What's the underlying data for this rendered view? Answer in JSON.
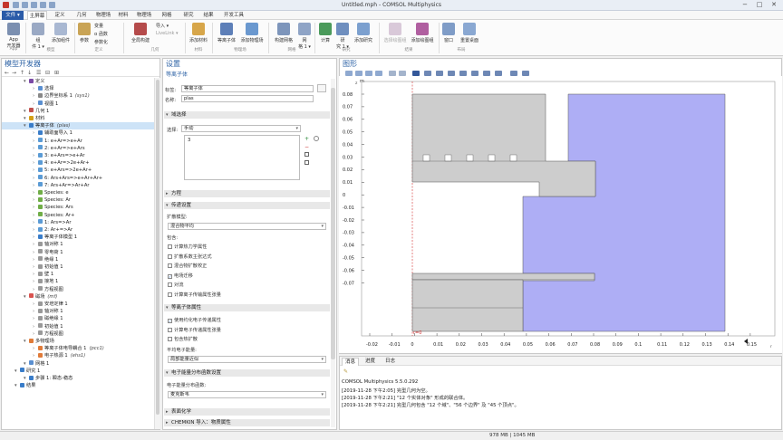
{
  "window": {
    "title": "Untitled.mph - COMSOL Multiphysics",
    "min": "−",
    "max": "□",
    "close": "✕"
  },
  "menu": [
    "文件 ▾",
    "主屏幕",
    "定义",
    "几何",
    "物理场",
    "材料",
    "物理场",
    "网格",
    "研究",
    "结果",
    "开发工具"
  ],
  "ribbon": {
    "buttons": [
      "App\n开发器",
      "组\n件 1 ▾",
      "添加组件",
      "参数",
      "变量",
      "α 函数",
      "全局构建",
      "添加材料",
      "等离子体",
      "添加物理场",
      "构建网格",
      "网\n格 1 ▾",
      "计算",
      "研\n究 1 ▾",
      "添加研究",
      "选择绘图组",
      "添加绘图组",
      "窗口",
      "重置桌面"
    ],
    "small": [
      "导入 ▾",
      "参数化",
      "构建所有",
      "LiveLink ▾"
    ],
    "groups": [
      "App",
      "模型",
      "定义",
      "几何",
      "材料",
      "物理场",
      "网格",
      "研究",
      "结果",
      "布局"
    ]
  },
  "model_builder": {
    "title": "模型开发器",
    "tree": [
      {
        "label": "定义",
        "italic": "",
        "lvl": 2,
        "color": "#7b4aa5"
      },
      {
        "label": "选择",
        "italic": "",
        "lvl": 3,
        "color": "#5a8fd0"
      },
      {
        "label": "边界坐标系 1",
        "italic": "(sys1)",
        "lvl": 3,
        "color": "#888888"
      },
      {
        "label": "视图 1",
        "italic": "",
        "lvl": 3,
        "color": "#5a8fd0"
      },
      {
        "label": "几何 1",
        "italic": "",
        "lvl": 2,
        "color": "#c0504d"
      },
      {
        "label": "材料",
        "italic": "",
        "lvl": 2,
        "color": "#d4a017"
      },
      {
        "label": "等离子体",
        "italic": "(plas)",
        "lvl": 2,
        "color": "#3a7dc9"
      },
      {
        "label": "辅助面导入 1",
        "italic": "",
        "lvl": 3,
        "color": "#3a7dc9"
      },
      {
        "label": "1: e+Ar=>e+Ar",
        "italic": "",
        "lvl": 3,
        "color": "#5b9bd5"
      },
      {
        "label": "2: e+Ar=>e+Ars",
        "italic": "",
        "lvl": 3,
        "color": "#5b9bd5"
      },
      {
        "label": "3: e+Ars=>e+Ar",
        "italic": "",
        "lvl": 3,
        "color": "#5b9bd5"
      },
      {
        "label": "4: e+Ar=>2e+Ar+",
        "italic": "",
        "lvl": 3,
        "color": "#5b9bd5"
      },
      {
        "label": "5: e+Ars=>2e+Ar+",
        "italic": "",
        "lvl": 3,
        "color": "#5b9bd5"
      },
      {
        "label": "6: Ars+Ars=>e+Ar+Ar+",
        "italic": "",
        "lvl": 3,
        "color": "#5b9bd5"
      },
      {
        "label": "7: Ars+Ar=>Ar+Ar",
        "italic": "",
        "lvl": 3,
        "color": "#5b9bd5"
      },
      {
        "label": "Species: e",
        "italic": "",
        "lvl": 3,
        "color": "#70ad47"
      },
      {
        "label": "Species: Ar",
        "italic": "",
        "lvl": 3,
        "color": "#70ad47"
      },
      {
        "label": "Species: Ars",
        "italic": "",
        "lvl": 3,
        "color": "#70ad47"
      },
      {
        "label": "Species: Ar+",
        "italic": "",
        "lvl": 3,
        "color": "#70ad47"
      },
      {
        "label": "1: Ars=>Ar",
        "italic": "",
        "lvl": 3,
        "color": "#5b9bd5"
      },
      {
        "label": "2: Ar+=>Ar",
        "italic": "",
        "lvl": 3,
        "color": "#5b9bd5"
      },
      {
        "label": "等离子体模型 1",
        "italic": "",
        "lvl": 3,
        "color": "#3a7dc9"
      },
      {
        "label": "轴对称 1",
        "italic": "",
        "lvl": 3,
        "color": "#999999"
      },
      {
        "label": "零电荷 1",
        "italic": "",
        "lvl": 3,
        "color": "#999999"
      },
      {
        "label": "绝缘 1",
        "italic": "",
        "lvl": 3,
        "color": "#999999"
      },
      {
        "label": "初始值 1",
        "italic": "",
        "lvl": 3,
        "color": "#999999"
      },
      {
        "label": "壁 1",
        "italic": "",
        "lvl": 3,
        "color": "#999999"
      },
      {
        "label": "接地 1",
        "italic": "",
        "lvl": 3,
        "color": "#999999"
      },
      {
        "label": "方程视图",
        "italic": "",
        "lvl": 3,
        "color": "#999999"
      },
      {
        "label": "磁场",
        "italic": "(mf)",
        "lvl": 2,
        "color": "#d9534f"
      },
      {
        "label": "安培定律 1",
        "italic": "",
        "lvl": 3,
        "color": "#999999"
      },
      {
        "label": "轴对称 1",
        "italic": "",
        "lvl": 3,
        "color": "#999999"
      },
      {
        "label": "磁绝缘 1",
        "italic": "",
        "lvl": 3,
        "color": "#999999"
      },
      {
        "label": "初始值 1",
        "italic": "",
        "lvl": 3,
        "color": "#999999"
      },
      {
        "label": "方程视图",
        "italic": "",
        "lvl": 3,
        "color": "#999999"
      },
      {
        "label": "多物理场",
        "italic": "",
        "lvl": 2,
        "color": "#e07b39"
      },
      {
        "label": "等离子体电导耦合 1",
        "italic": "(pcc1)",
        "lvl": 3,
        "color": "#e07b39"
      },
      {
        "label": "电子热源 1",
        "italic": "(ehs1)",
        "lvl": 3,
        "color": "#e07b39"
      },
      {
        "label": "网格 1",
        "italic": "",
        "lvl": 2,
        "color": "#5a8fd0"
      },
      {
        "label": "研究 1",
        "italic": "",
        "lvl": 1,
        "color": "#3a7dc9"
      },
      {
        "label": "步骤 1: 瞬态-稳态",
        "italic": "",
        "lvl": 2,
        "color": "#3a7dc9"
      },
      {
        "label": "结果",
        "italic": "",
        "lvl": 1,
        "color": "#3a7dc9"
      }
    ]
  },
  "settings": {
    "title": "设置",
    "subtitle": "等离子体",
    "label_lbl": "标签:",
    "label_val": "等离子体",
    "name_lbl": "名称:",
    "name_val": "plas",
    "sec_domain": "域选择",
    "select_lbl": "选择:",
    "select_val": "手动",
    "domain_item": "3",
    "sec_equation": "方程",
    "sec_transport": "传递设置",
    "diffusion_lbl": "扩散模型:",
    "diffusion_val": "混合物平均",
    "include_lbl": "包含:",
    "checks": [
      {
        "label": "计算热力学属性",
        "checked": false
      },
      {
        "label": "扩散系数主张达式",
        "checked": false
      },
      {
        "label": "混合物扩散校正",
        "checked": false
      },
      {
        "label": "电场迁移",
        "checked": true
      },
      {
        "label": "对流",
        "checked": false
      },
      {
        "label": "计算离子传输属性张量",
        "checked": false
      }
    ],
    "sec_plasma": "等离子体属性",
    "checks2": [
      {
        "label": "使用约化电子传递属性",
        "checked": true
      },
      {
        "label": "计算电子传递属性张量",
        "checked": false
      },
      {
        "label": "包含热扩散",
        "checked": false
      }
    ],
    "mean_lbl": "平均电子能量:",
    "mean_val": "局部能量近似",
    "sec_eedf": "电子能量分布函数设置",
    "eedf_lbl": "电子能量分布函数:",
    "eedf_val": "麦克斯韦",
    "sec_chem": "表面化学",
    "sec_chemkin": "CHEMKIN 导入：物质属性"
  },
  "graphics": {
    "title": "图形",
    "x_ticks": [
      "-0.02",
      "-0.01",
      "0",
      "0.01",
      "0.02",
      "0.03",
      "0.04",
      "0.05",
      "0.06",
      "0.07",
      "0.08",
      "0.09",
      "0.1",
      "0.11",
      "0.12",
      "0.13",
      "0.14",
      "0.15"
    ],
    "y_ticks": [
      "0.08",
      "0.07",
      "0.06",
      "0.05",
      "0.04",
      "0.03",
      "0.02",
      "0.01",
      "0",
      "-0.01",
      "-0.02",
      "-0.03",
      "-0.04",
      "-0.05",
      "-0.06",
      "-0.07"
    ],
    "unit": "m",
    "axis_z": "z",
    "axis_r": "r",
    "origin": "r=0"
  },
  "messages": {
    "tabs": [
      "消息",
      "进度",
      "日志"
    ],
    "lines": [
      "COMSOL Multiphysics 5.5.0.292",
      "[2019-11-28 下午2:05] 完型几何为空。",
      "[2019-11-28 下午2:21] \"12 个实体对象\" 形成的联合体。",
      "[2019-11-28 下午2:21] 完型几何包含 \"12 个域\"、\"56 个边界\" 及 \"45 个顶点\"。"
    ]
  },
  "status": {
    "memory": "978 MB | 1045 MB"
  }
}
